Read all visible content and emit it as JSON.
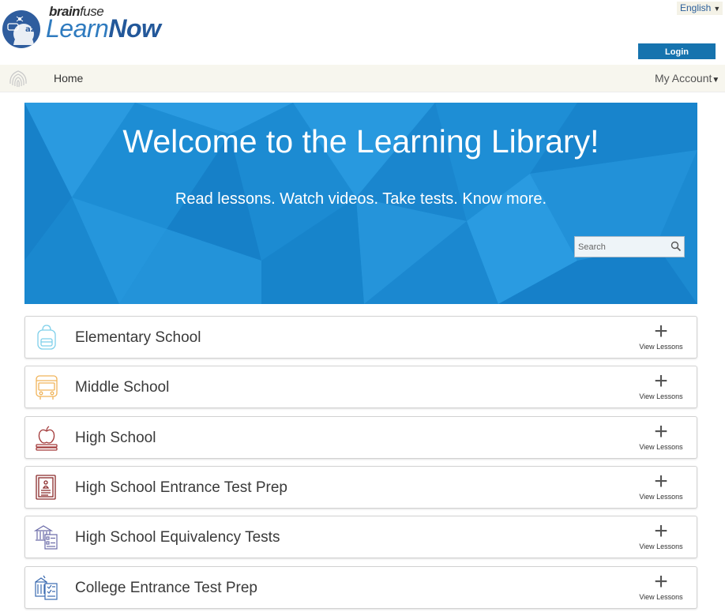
{
  "header": {
    "brand_top_bold": "brain",
    "brand_top_regular": "fuse",
    "brand_learn": "Learn",
    "brand_now": "Now",
    "language": "English",
    "login_label": "Login",
    "logo_text": "az"
  },
  "nav": {
    "home": "Home",
    "account": "My Account"
  },
  "banner": {
    "title": "Welcome to the Learning Library!",
    "subtitle": "Read lessons. Watch videos. Take tests. Know more.",
    "search_placeholder": "Search"
  },
  "categories": [
    {
      "label": "Elementary School",
      "icon": "backpack-icon",
      "color": "#7fd0ea",
      "action": "View Lessons"
    },
    {
      "label": "Middle School",
      "icon": "school-bus-icon",
      "color": "#f0b45a",
      "action": "View Lessons"
    },
    {
      "label": "High School",
      "icon": "apple-books-icon",
      "color": "#a33a3a",
      "action": "View Lessons"
    },
    {
      "label": "High School Entrance Test Prep",
      "icon": "test-document-icon",
      "color": "#8a2a2a",
      "action": "View Lessons"
    },
    {
      "label": "High School Equivalency Tests",
      "icon": "institution-checklist-icon",
      "color": "#6a6aa8",
      "action": "View Lessons"
    },
    {
      "label": "College Entrance Test Prep",
      "icon": "college-checklist-icon",
      "color": "#3a6ab0",
      "action": "View Lessons"
    }
  ],
  "colors": {
    "banner_blue": "#1e8fd6",
    "login_blue": "#1673ae",
    "brand_blue": "#2f7bbf",
    "navbar_bg": "#f7f6ee"
  }
}
